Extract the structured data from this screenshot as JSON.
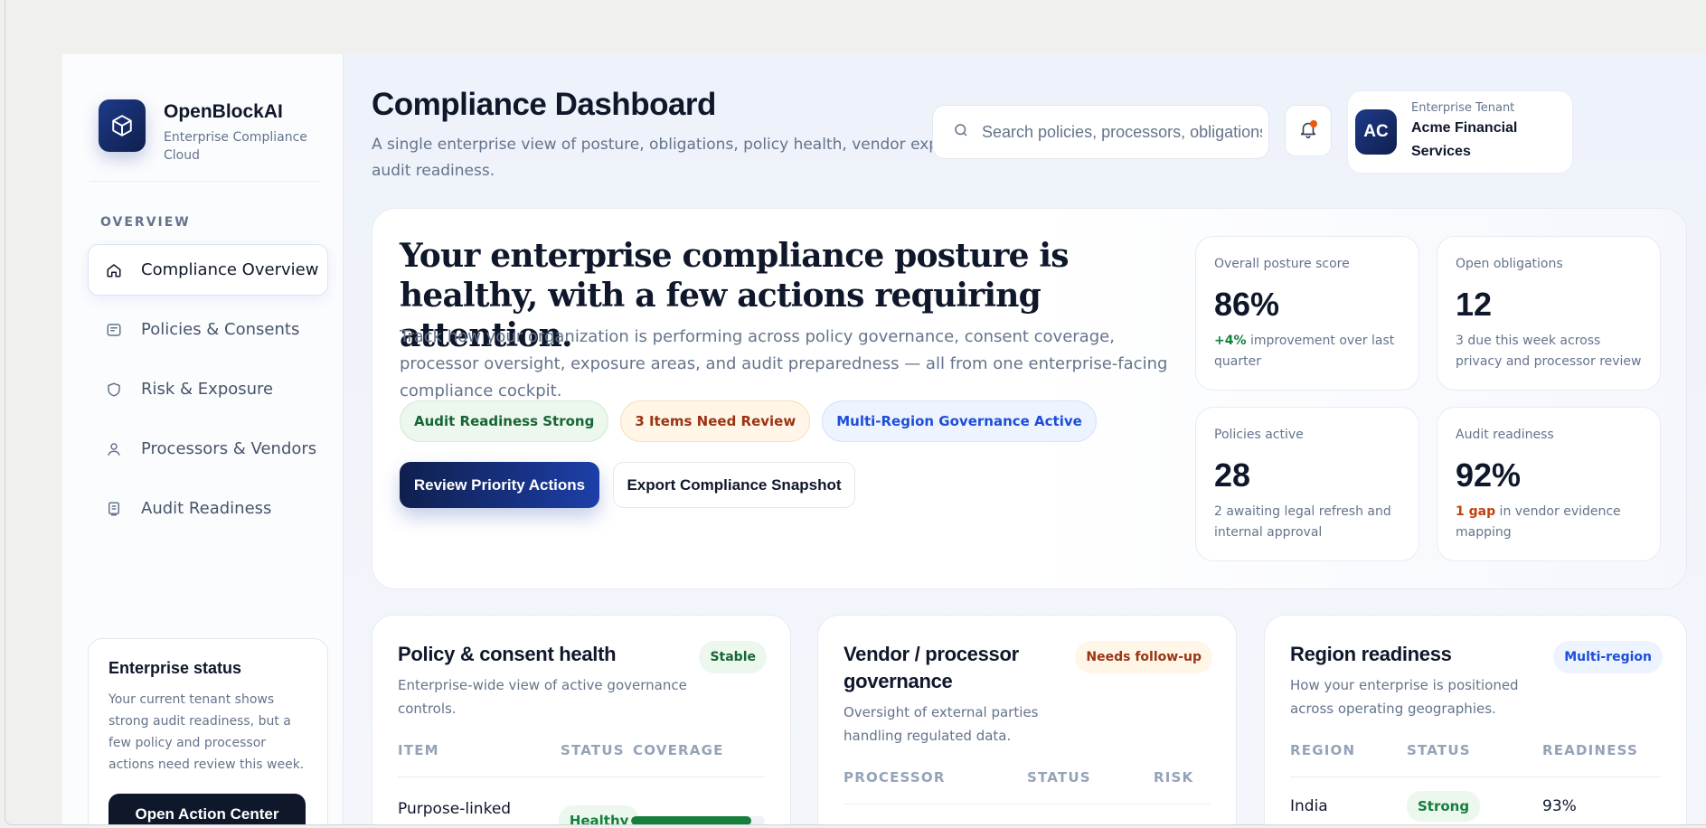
{
  "brand": {
    "name": "OpenBlockAI",
    "subtitle": "Enterprise Compliance Cloud",
    "logo_icon": "cube-icon"
  },
  "sidebar": {
    "section_label": "OVERVIEW",
    "items": [
      {
        "label": "Compliance Overview",
        "icon": "home-icon",
        "active": true
      },
      {
        "label": "Policies & Consents",
        "icon": "document-icon",
        "active": false
      },
      {
        "label": "Risk & Exposure",
        "icon": "shield-icon",
        "active": false
      },
      {
        "label": "Processors & Vendors",
        "icon": "user-icon",
        "active": false
      },
      {
        "label": "Audit Readiness",
        "icon": "clipboard-icon",
        "active": false
      }
    ],
    "status_card": {
      "title": "Enterprise status",
      "body": "Your current tenant shows strong audit readiness, but a few policy and processor actions need review this week.",
      "button": "Open Action Center"
    }
  },
  "header": {
    "title": "Compliance Dashboard",
    "subtitle": "A single enterprise view of posture, obligations, policy health, vendor exposure, and audit readiness.",
    "search_placeholder": "Search policies, processors, obligations",
    "tenant_label": "Enterprise Tenant",
    "tenant_name": "Acme Financial Services",
    "avatar_initials": "AC"
  },
  "hero": {
    "title": "Your enterprise compliance posture is healthy, with a few actions requiring attention.",
    "body": "Track how your organization is performing across policy governance, consent coverage, processor oversight, exposure areas, and audit preparedness — all from one enterprise-facing compliance cockpit.",
    "chips": [
      "Audit Readiness Strong",
      "3 Items Need Review",
      "Multi-Region Governance Active"
    ],
    "primary_button": "Review Priority Actions",
    "secondary_button": "Export Compliance Snapshot"
  },
  "metrics": [
    {
      "label": "Overall posture score",
      "value": "86%",
      "highlight": "+4%",
      "note": " improvement over last quarter"
    },
    {
      "label": "Open obligations",
      "value": "12",
      "highlight": "",
      "note": "3 due this week across privacy and processor review"
    },
    {
      "label": "Policies active",
      "value": "28",
      "highlight": "",
      "note": "2 awaiting legal refresh and internal approval"
    },
    {
      "label": "Audit readiness",
      "value": "92%",
      "highlight": "1 gap",
      "note": " in vendor evidence mapping"
    }
  ],
  "cards": {
    "policy": {
      "title": "Policy & consent health",
      "subtitle": "Enterprise-wide view of active governance controls.",
      "badge": "Stable",
      "columns": [
        "ITEM",
        "STATUS",
        "COVERAGE"
      ],
      "rows": [
        {
          "item": "Purpose-linked consent notices",
          "status": "Healthy",
          "coverage": 0.9
        }
      ]
    },
    "vendor": {
      "title": "Vendor / processor governance",
      "subtitle": "Oversight of external parties handling regulated data.",
      "badge": "Needs follow-up",
      "columns": [
        "PROCESSOR",
        "STATUS",
        "RISK"
      ]
    },
    "region": {
      "title": "Region readiness",
      "subtitle": "How your enterprise is positioned across operating geographies.",
      "badge": "Multi-region",
      "columns": [
        "REGION",
        "STATUS",
        "READINESS"
      ],
      "rows": [
        {
          "region": "India",
          "status": "Strong",
          "readiness": "93%"
        }
      ]
    }
  },
  "colors": {
    "accent": "#1e3a8a",
    "dark": "#0f172a",
    "success": "#15803d",
    "warning": "#c2410c",
    "info": "#1d4ed8"
  }
}
